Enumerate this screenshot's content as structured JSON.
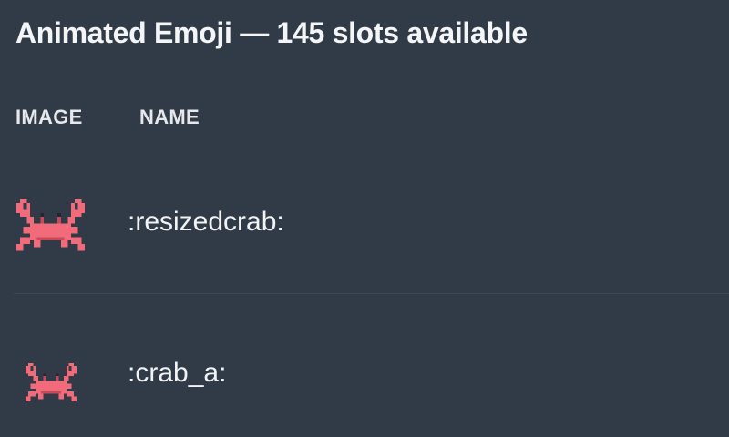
{
  "section": {
    "title": "Animated Emoji — 145 slots available"
  },
  "columns": {
    "image": "IMAGE",
    "name": "NAME"
  },
  "emojis": [
    {
      "name": ":resizedcrab:",
      "icon": "crab-icon"
    },
    {
      "name": ":crab_a:",
      "icon": "crab-icon"
    }
  ],
  "colors": {
    "background": "#313b48",
    "crab": "#f26b7a",
    "crab_dark": "#c9485a",
    "divider": "#3d4756"
  }
}
